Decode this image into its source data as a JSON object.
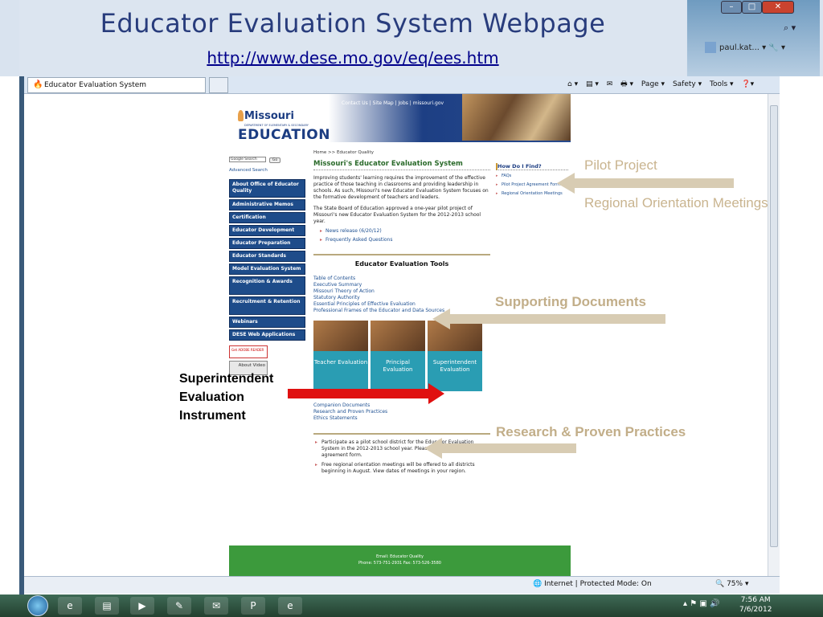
{
  "slide": {
    "title": "Educator Evaluation System Webpage",
    "url": "http://www.dese.mo.gov/eq/ees.htm"
  },
  "browser": {
    "tab_title": "Educator Evaluation System",
    "user": "paul.kat...",
    "cmd": [
      "Page ▾",
      "Safety ▾",
      "Tools ▾"
    ],
    "status_zone": "Internet | Protected Mode: On",
    "zoom": "75%"
  },
  "taskbar": {
    "time": "7:56 AM",
    "date": "7/6/2012"
  },
  "site": {
    "header_links": "Contact Us | Site Map | Jobs | missouri.gov",
    "logo_top": "Missouri",
    "logo_dept": "DEPARTMENT OF ELEMENTARY & SECONDARY",
    "logo_bottom": "EDUCATION",
    "search_label": "Google Search",
    "search_go": "Go",
    "advanced_search": "Advanced Search",
    "nav": [
      "About Office of Educator Quality",
      "Administrative Memos",
      "Certification",
      "Educator Development",
      "Educator Preparation",
      "Educator Standards",
      "Model Evaluation System",
      "Recognition & Awards",
      "Recruitment & Retention",
      "Webinars",
      "DESE Web Applications"
    ],
    "adobe_label": "Get ADOBE READER",
    "about_video": "About Video",
    "breadcrumb": "Home >> Educator Quality",
    "heading": "Missouri's Educator Evaluation System",
    "para1": "Improving students' learning requires the improvement of the effective practice of those teaching in classrooms and providing leadership in schools. As such, Missouri's new Educator Evaluation System focuses on the formative development of teachers and leaders.",
    "para2": "The State Board of Education approved a one-year pilot project of Missouri's new Educator Evaluation System for the 2012-2013 school year.",
    "bullets": [
      "News release (6/20/12)",
      "Frequently Asked Questions"
    ],
    "tools_heading": "Educator Evaluation Tools",
    "tools": [
      "Table of Contents",
      "Executive Summary",
      "Missouri Theory of Action",
      "Statutory Authority",
      "Essential Principles of Effective Evaluation",
      "Professional Frames of the Educator and Data Sources"
    ],
    "tiles": [
      "Teacher Evaluation",
      "Principal Evaluation",
      "Superintendent Evaluation"
    ],
    "companion": [
      "Companion Documents",
      "Research and Proven Practices",
      "Ethics Statements"
    ],
    "participate": [
      "Participate as a pilot school district for the Educator Evaluation System in the 2012-2013 school year. Please fill out and return the agreement form.",
      "Free regional orientation meetings will be offered to all districts beginning in August. View dates of meetings in your region."
    ],
    "howdo_heading": "How Do I Find?",
    "howdo": [
      "FAQs",
      "Pilot Project Agreement Form",
      "Regional Orientation Meetings"
    ],
    "footer": "Email: Educator Quality\nPhone: 573-751-2931 Fax: 573-526-3580"
  },
  "annotations": {
    "pilot": "Pilot Project",
    "regional": "Regional Orientation Meetings",
    "supporting": "Supporting Documents",
    "research": "Research & Proven Practices",
    "superintendent": "Superintendent Evaluation Instrument"
  }
}
